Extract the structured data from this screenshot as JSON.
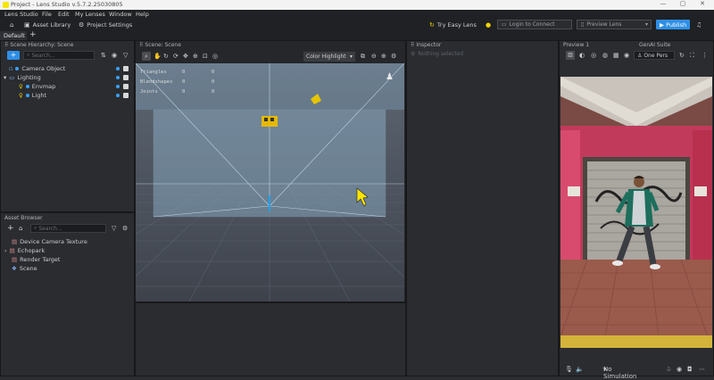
{
  "window": {
    "title": "Project - Lens Studio v.5.7.2.25030805",
    "controls": [
      "—",
      "▢",
      "✕"
    ]
  },
  "menu": [
    "Lens Studio",
    "File",
    "Edit",
    "My Lenses",
    "Window",
    "Help"
  ],
  "toolbar": {
    "asset_library": "Asset Library",
    "project_settings": "Project Settings",
    "try_easy_lens": "Try Easy Lens",
    "login": "Login to Connect",
    "preview_lens": "Preview Lens",
    "publish": "Publish"
  },
  "workspace_tab": "Default",
  "hierarchy": {
    "title": "Scene Hierarchy: Scene",
    "search_placeholder": "Search...",
    "items": [
      "Camera Object",
      "Lighting",
      "Envmap",
      "Light"
    ]
  },
  "scene": {
    "title": "Scene: Scene",
    "dropdown": "Color Highlight",
    "stats": [
      {
        "label": "Triangles",
        "a": "0",
        "b": "0"
      },
      {
        "label": "Blendshapes",
        "a": "0",
        "b": "0"
      },
      {
        "label": "Joints",
        "a": "0",
        "b": "0"
      }
    ]
  },
  "inspector": {
    "title": "Inspector",
    "empty": "Nothing selected"
  },
  "preview": {
    "title": "Preview 1",
    "genai": "GenAI Suite",
    "device": "One Pers",
    "simulation": "No Simulation"
  },
  "assets": {
    "title": "Asset Browser",
    "search_placeholder": "Search...",
    "items": [
      "Device Camera Texture",
      "Echopark",
      "Render Target",
      "Scene"
    ]
  }
}
